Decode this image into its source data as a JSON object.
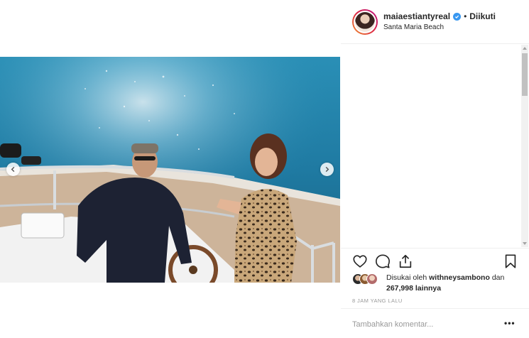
{
  "post": {
    "username": "maiaestiantyreal",
    "follow_status": "Diikuti",
    "separator": "•",
    "location": "Santa Maria Beach"
  },
  "media": {
    "description_icon": "photo-of-two-people-on-yacht"
  },
  "actions": {
    "like_icon": "heart-icon",
    "comment_icon": "comment-icon",
    "share_icon": "share-icon",
    "save_icon": "bookmark-icon"
  },
  "likes": {
    "prefix": "Disukai oleh",
    "user": "withneysambono",
    "conj": "dan",
    "count": "267,998",
    "suffix": "lainnya"
  },
  "time": "8 JAM YANG LALU",
  "comment": {
    "placeholder": "Tambahkan komentar...",
    "more_label": "•••"
  },
  "colors": {
    "verified": "#3897f0",
    "border": "#efefef",
    "muted": "#999999",
    "text": "#262626"
  }
}
